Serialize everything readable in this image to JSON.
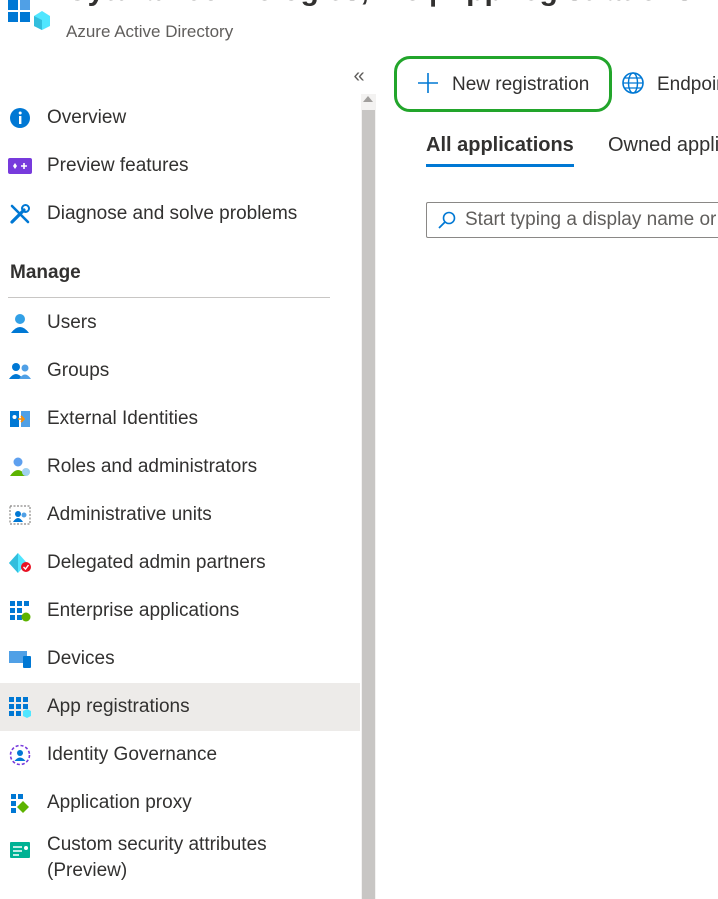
{
  "header": {
    "title": "Cytura Technologies, Inc | App registrations",
    "subtitle": "Azure Active Directory"
  },
  "sidebar": {
    "collapse_glyph": "«",
    "items_top": [
      {
        "label": "Overview",
        "icon": "info-icon"
      },
      {
        "label": "Preview features",
        "icon": "preview-features-icon"
      },
      {
        "label": "Diagnose and solve problems",
        "icon": "wrench-icon"
      }
    ],
    "manage_header": "Manage",
    "items_manage": [
      {
        "label": "Users",
        "icon": "user-icon"
      },
      {
        "label": "Groups",
        "icon": "groups-icon"
      },
      {
        "label": "External Identities",
        "icon": "external-identities-icon"
      },
      {
        "label": "Roles and administrators",
        "icon": "roles-icon"
      },
      {
        "label": "Administrative units",
        "icon": "admin-units-icon"
      },
      {
        "label": "Delegated admin partners",
        "icon": "delegated-partners-icon"
      },
      {
        "label": "Enterprise applications",
        "icon": "enterprise-apps-icon"
      },
      {
        "label": "Devices",
        "icon": "devices-icon"
      },
      {
        "label": "App registrations",
        "icon": "app-registrations-icon",
        "selected": true
      },
      {
        "label": "Identity Governance",
        "icon": "identity-governance-icon"
      },
      {
        "label": "Application proxy",
        "icon": "application-proxy-icon"
      },
      {
        "label": "Custom security attributes\n(Preview)",
        "icon": "custom-security-icon"
      }
    ]
  },
  "toolbar": {
    "new_registration": "New registration",
    "endpoints": "Endpoints"
  },
  "tabs": [
    {
      "label": "All applications",
      "active": true
    },
    {
      "label": "Owned applications",
      "active": false
    }
  ],
  "search": {
    "placeholder": "Start typing a display name or application (client) ID to filter these r..."
  },
  "colors": {
    "accent": "#0078d4",
    "highlight_ring": "#22a52b",
    "selected_bg": "#edebe9"
  }
}
